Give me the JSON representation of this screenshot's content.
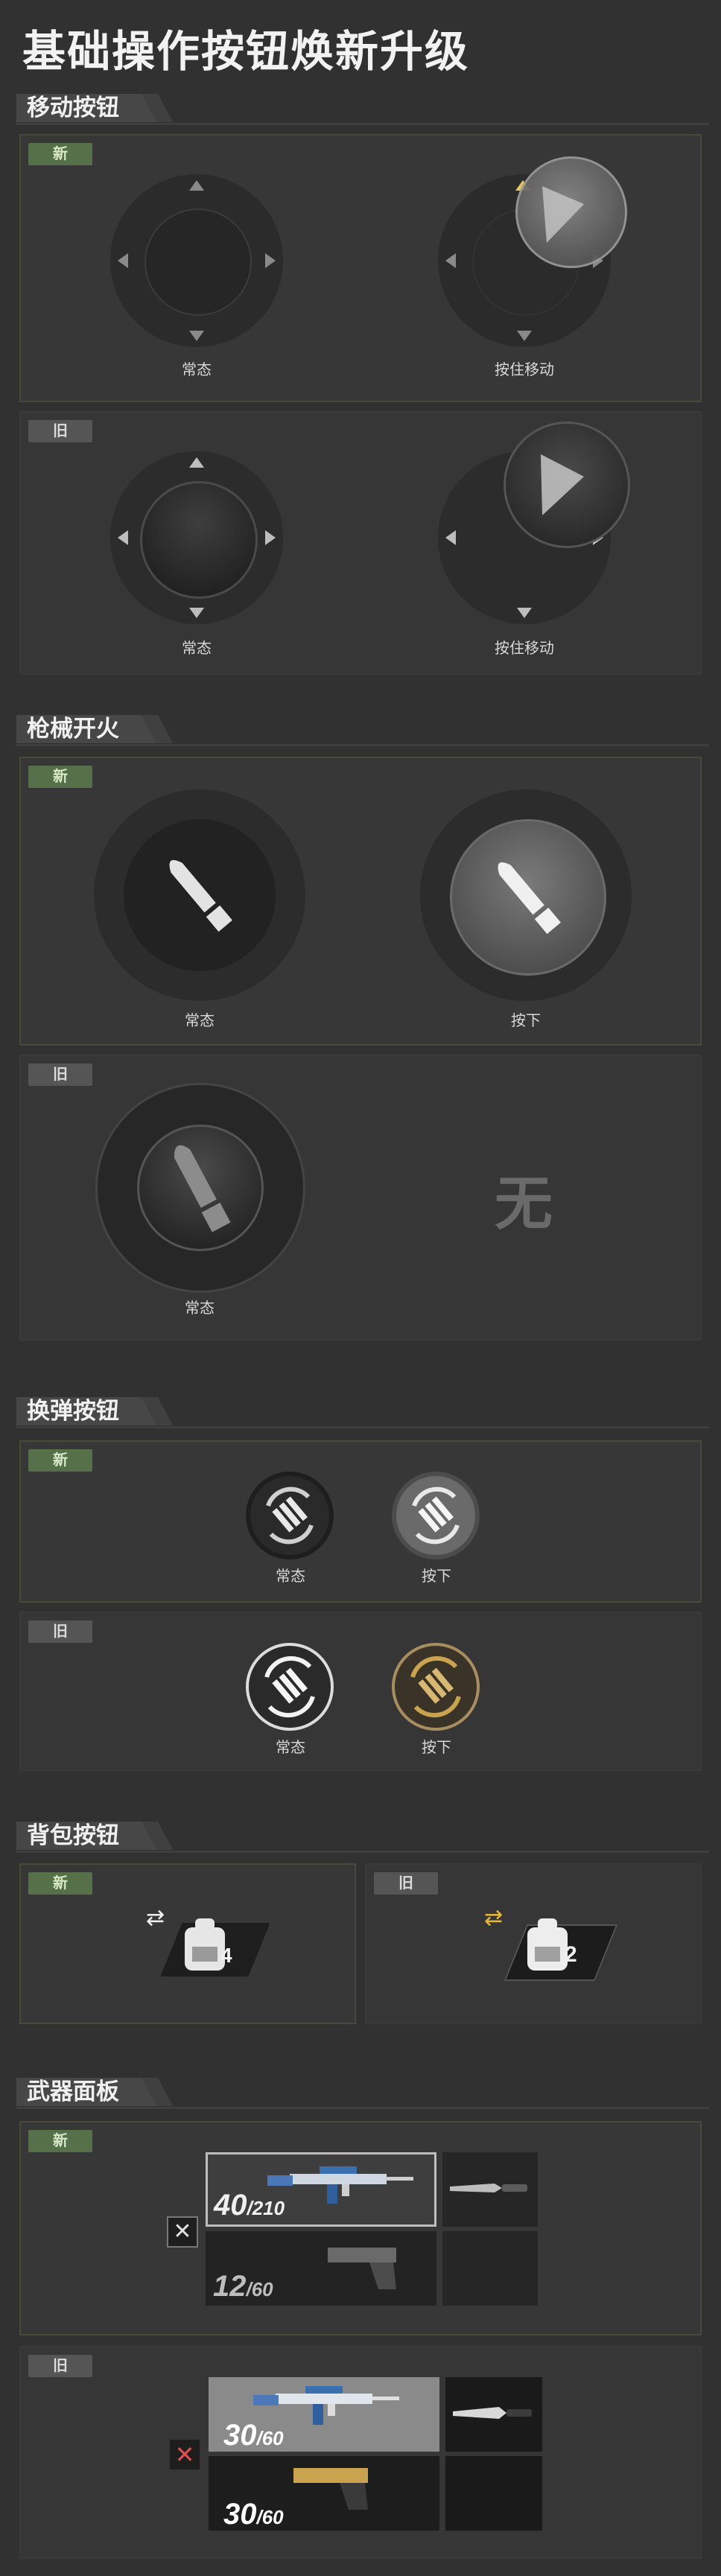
{
  "page_title": "基础操作按钮焕新升级",
  "badges": {
    "new": "新",
    "old": "旧"
  },
  "sections": {
    "move": {
      "title": "移动按钮",
      "new": {
        "normal": "常态",
        "pressed": "按住移动"
      },
      "old": {
        "normal": "常态",
        "pressed": "按住移动"
      }
    },
    "fire": {
      "title": "枪械开火",
      "new": {
        "normal": "常态",
        "pressed": "按下"
      },
      "old": {
        "normal": "常态",
        "pressed_none": "无"
      }
    },
    "reload": {
      "title": "换弹按钮",
      "new": {
        "normal": "常态",
        "pressed": "按下"
      },
      "old": {
        "normal": "常态",
        "pressed": "按下"
      }
    },
    "backpack": {
      "title": "背包按钮",
      "new": {
        "count": "4"
      },
      "old": {
        "count": "2"
      }
    },
    "weapon_panel": {
      "title": "武器面板",
      "new": {
        "primary_ammo": "40",
        "primary_reserve": "/210",
        "secondary_ammo": "12",
        "secondary_reserve": "/60"
      },
      "old": {
        "primary_ammo": "30",
        "primary_reserve": "/60",
        "secondary_ammo": "30",
        "secondary_reserve": "/60"
      }
    }
  },
  "icons": {
    "arrow": "triangle-arrow-icon",
    "bullet": "bullet-icon",
    "reload": "reload-bullets-icon",
    "backpack": "backpack-icon",
    "swap": "swap-arrows-icon",
    "rifle": "rifle-icon",
    "pistol": "pistol-icon",
    "knife": "knife-icon",
    "close": "close-x-icon"
  },
  "colors": {
    "new_badge": "#56704a",
    "old_badge": "#555555",
    "accent_yellow": "#e6c85a",
    "gold": "#c9a34d"
  }
}
